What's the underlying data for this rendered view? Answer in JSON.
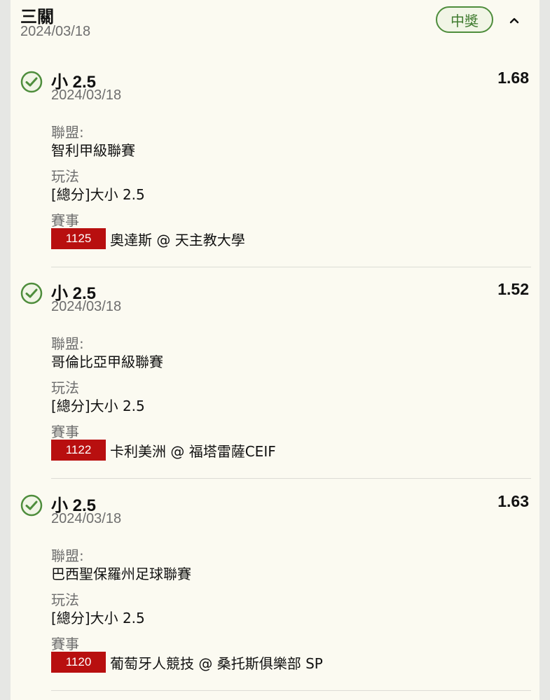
{
  "parlay": {
    "title": "三關",
    "date": "2024/03/18",
    "status": "中獎"
  },
  "labels": {
    "league": "聯盟:",
    "play": "玩法",
    "event": "賽事"
  },
  "bets": [
    {
      "selection": "小 2.5",
      "date": "2024/03/18",
      "odds": "1.68",
      "league": "智利甲級聯賽",
      "play": "[總分]大小 2.5",
      "match_id": "1125",
      "match": "奧達斯 @ 天主教大學"
    },
    {
      "selection": "小 2.5",
      "date": "2024/03/18",
      "odds": "1.52",
      "league": "哥倫比亞甲級聯賽",
      "play": "[總分]大小 2.5",
      "match_id": "1122",
      "match": "卡利美洲 @ 福塔雷薩CEIF"
    },
    {
      "selection": "小 2.5",
      "date": "2024/03/18",
      "odds": "1.63",
      "league": "巴西聖保羅州足球聯賽",
      "play": "[總分]大小 2.5",
      "match_id": "1120",
      "match": "葡萄牙人競技 @ 桑托斯俱樂部 SP"
    }
  ],
  "colors": {
    "win_green": "#4e8d3c",
    "match_id_red": "#b80f0f",
    "card_bg": "#fbfaf1"
  },
  "icons": {
    "check": "check-circle-icon",
    "collapse": "chevron-up-icon"
  }
}
